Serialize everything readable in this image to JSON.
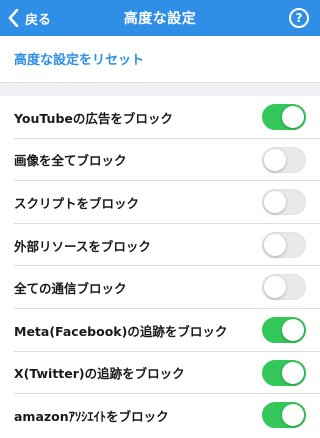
{
  "nav": {
    "back_label": "戻る",
    "title": "高度な設定",
    "help_label": "?"
  },
  "reset": {
    "label": "高度な設定をリセット"
  },
  "colors": {
    "accent": "#2f8fe6",
    "toggle_on": "#34c759",
    "toggle_off": "#e9e9ea"
  },
  "settings": [
    {
      "label": "YouTubeの広告をブロック",
      "on": true
    },
    {
      "label": "画像を全てブロック",
      "on": false
    },
    {
      "label": "スクリプトをブロック",
      "on": false
    },
    {
      "label": "外部リソースをブロック",
      "on": false
    },
    {
      "label": "全ての通信ブロック",
      "on": false
    },
    {
      "label": "Meta(Facebook)の追跡をブロック",
      "on": true
    },
    {
      "label": "X(Twitter)の追跡をブロック",
      "on": true
    },
    {
      "label": "amazonｱｿｼｴｲﾄをブロック",
      "on": true
    }
  ]
}
